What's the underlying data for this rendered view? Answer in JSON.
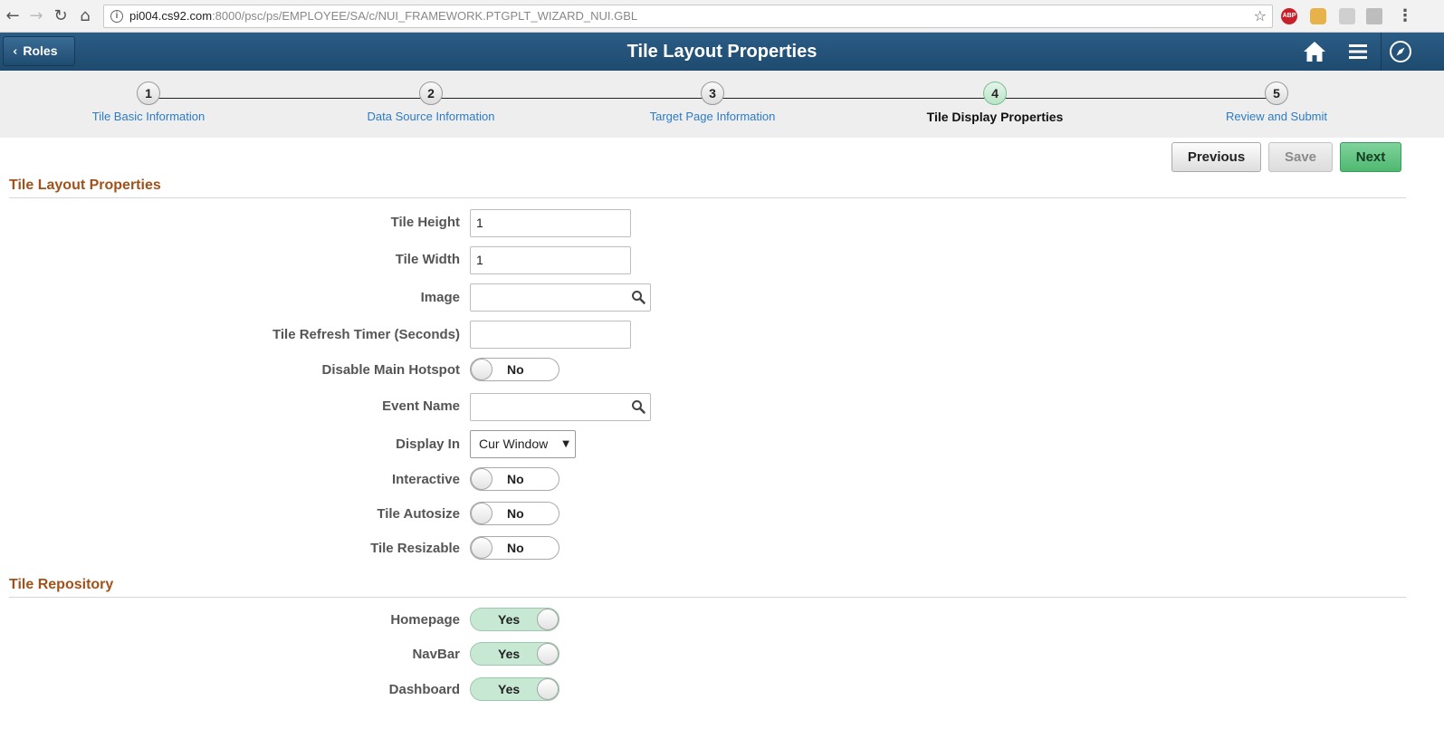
{
  "browser": {
    "url_host": "pi004.cs92.com",
    "url_path": ":8000/psc/ps/EMPLOYEE/SA/c/NUI_FRAMEWORK.PTGPLT_WIZARD_NUI.GBL",
    "ext_abp": "ABP"
  },
  "header": {
    "back_label": "Roles",
    "title": "Tile Layout Properties"
  },
  "train": {
    "steps": [
      {
        "num": "1",
        "label": "Tile Basic Information"
      },
      {
        "num": "2",
        "label": "Data Source Information"
      },
      {
        "num": "3",
        "label": "Target Page Information"
      },
      {
        "num": "4",
        "label": "Tile Display Properties"
      },
      {
        "num": "5",
        "label": "Review and Submit"
      }
    ],
    "active_step": 4
  },
  "actions": {
    "previous": "Previous",
    "save": "Save",
    "next": "Next"
  },
  "layout_section": {
    "title": "Tile Layout Properties",
    "tile_height": {
      "label": "Tile Height",
      "value": "1"
    },
    "tile_width": {
      "label": "Tile Width",
      "value": "1"
    },
    "image": {
      "label": "Image",
      "value": ""
    },
    "refresh_timer": {
      "label": "Tile Refresh Timer (Seconds)",
      "value": ""
    },
    "disable_hotspot": {
      "label": "Disable Main Hotspot",
      "value": "No"
    },
    "event_name": {
      "label": "Event Name",
      "value": ""
    },
    "display_in": {
      "label": "Display In",
      "value": "Cur Window"
    },
    "interactive": {
      "label": "Interactive",
      "value": "No"
    },
    "autosize": {
      "label": "Tile Autosize",
      "value": "No"
    },
    "resizable": {
      "label": "Tile Resizable",
      "value": "No"
    }
  },
  "repository_section": {
    "title": "Tile Repository",
    "homepage": {
      "label": "Homepage",
      "value": "Yes"
    },
    "navbar": {
      "label": "NavBar",
      "value": "Yes"
    },
    "dashboard": {
      "label": "Dashboard",
      "value": "Yes"
    }
  },
  "colors": {
    "header_bg": "#1e4a6e",
    "section_title": "#a0521a",
    "link": "#2d7bc4",
    "next_button": "#4fb870",
    "toggle_on": "#c7e8d3"
  }
}
